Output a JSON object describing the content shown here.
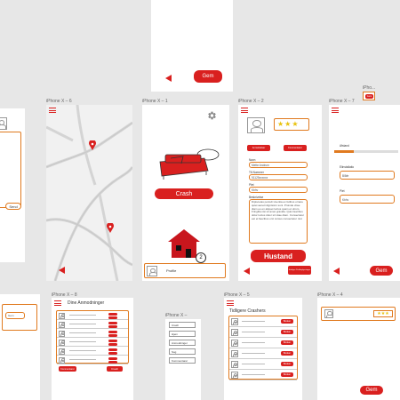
{
  "frames": {
    "top": {
      "save_label": "Gem"
    },
    "x6": {
      "label": "iPhone X – 6"
    },
    "x1": {
      "label": "iPhone X – 1",
      "crash_label": "Crash",
      "badge_count": "2",
      "profile_label": "Profile"
    },
    "x2": {
      "label": "iPhone X – 2",
      "button_left": "Anmeldelser",
      "button_right": "Kommentarer",
      "name_label": "Navn",
      "name_value": "Mette Andrum",
      "phone_label": "Tlf-Nummer",
      "phone_value": "51125xxxxxx",
      "place_label": "Plet",
      "place_value": "Kbhv",
      "description_label": "Beskrivelse",
      "description_text": "Dipiscetas periodi viventia ex fetibus ornare quiet aeneti dignissim suni. Proinde vitae diam eu en aliquet luctus quam et utrum. Fringilla nisi sit amet gravida. Quis faucibus dolor luctus dolor sit vitae diam. Consectetur est et faucibus orci cursus consectetur nisl.",
      "hustand_label": "Hustand",
      "profile_edit_label": "Rediger Profiloplysninger"
    },
    "x7": {
      "label": "iPhone X – 7",
      "progress_label": "Afstand",
      "progress_value": 0.3,
      "field1_label": "Elinstallatio",
      "field1_value": "Blåfe",
      "field2_label": "Plet",
      "field2_value": "Kbhv",
      "save_label": "Gem"
    },
    "small_top_right": {
      "label": "iPho...",
      "button": "Gem"
    },
    "left_mid": {
      "send_label": "Send"
    },
    "bottom_left": {
      "button": "Gem"
    },
    "x8": {
      "label": "iPhone X – 8",
      "title": "Dine Anmodninger",
      "rows": 6,
      "btn_left": "Kommentarer",
      "btn_right": "Crash"
    },
    "menu": {
      "label": "iPhone X –",
      "items": [
        "Crash",
        "Hjem",
        "Anmodninger",
        "Sog",
        "Kommentarer"
      ]
    },
    "x5": {
      "label": "iPhone X – 5",
      "title": "Tidligere Crashers",
      "rows": 6,
      "row_button": "Booker"
    },
    "x4": {
      "label": "iPhone X – 4",
      "save_label": "Gem"
    }
  },
  "colors": {
    "accent": "#d9201f",
    "border": "#e07a1f",
    "star": "#e8c20c"
  },
  "icons": [
    "hamburger-icon",
    "back-arrow-icon",
    "gear-icon",
    "map-pin-icon",
    "house-icon",
    "avatar-icon",
    "star-icon",
    "sofa-icon"
  ]
}
